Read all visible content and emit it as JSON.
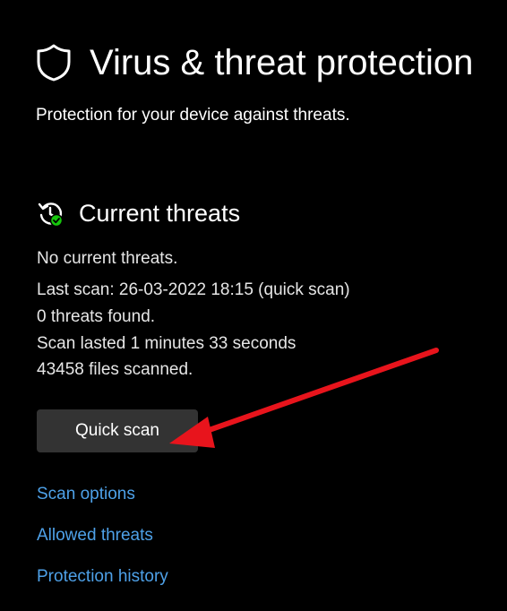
{
  "header": {
    "title": "Virus & threat protection",
    "subtitle": "Protection for your device against threats.",
    "icon": "shield-icon"
  },
  "current_threats": {
    "title": "Current threats",
    "icon": "history-check-icon",
    "status_lines": [
      "No current threats.",
      "Last scan: 26-03-2022 18:15 (quick scan)",
      "0 threats found.",
      "Scan lasted 1 minutes 33 seconds",
      "43458 files scanned."
    ]
  },
  "actions": {
    "quick_scan_label": "Quick scan"
  },
  "links": [
    "Scan options",
    "Allowed threats",
    "Protection history"
  ],
  "annotation": {
    "icon": "red-arrow-icon",
    "color": "#e8141c"
  },
  "colors": {
    "background": "#000000",
    "text": "#ffffff",
    "link": "#4ea1e8",
    "button": "#333333",
    "badge": "#16c60c"
  }
}
